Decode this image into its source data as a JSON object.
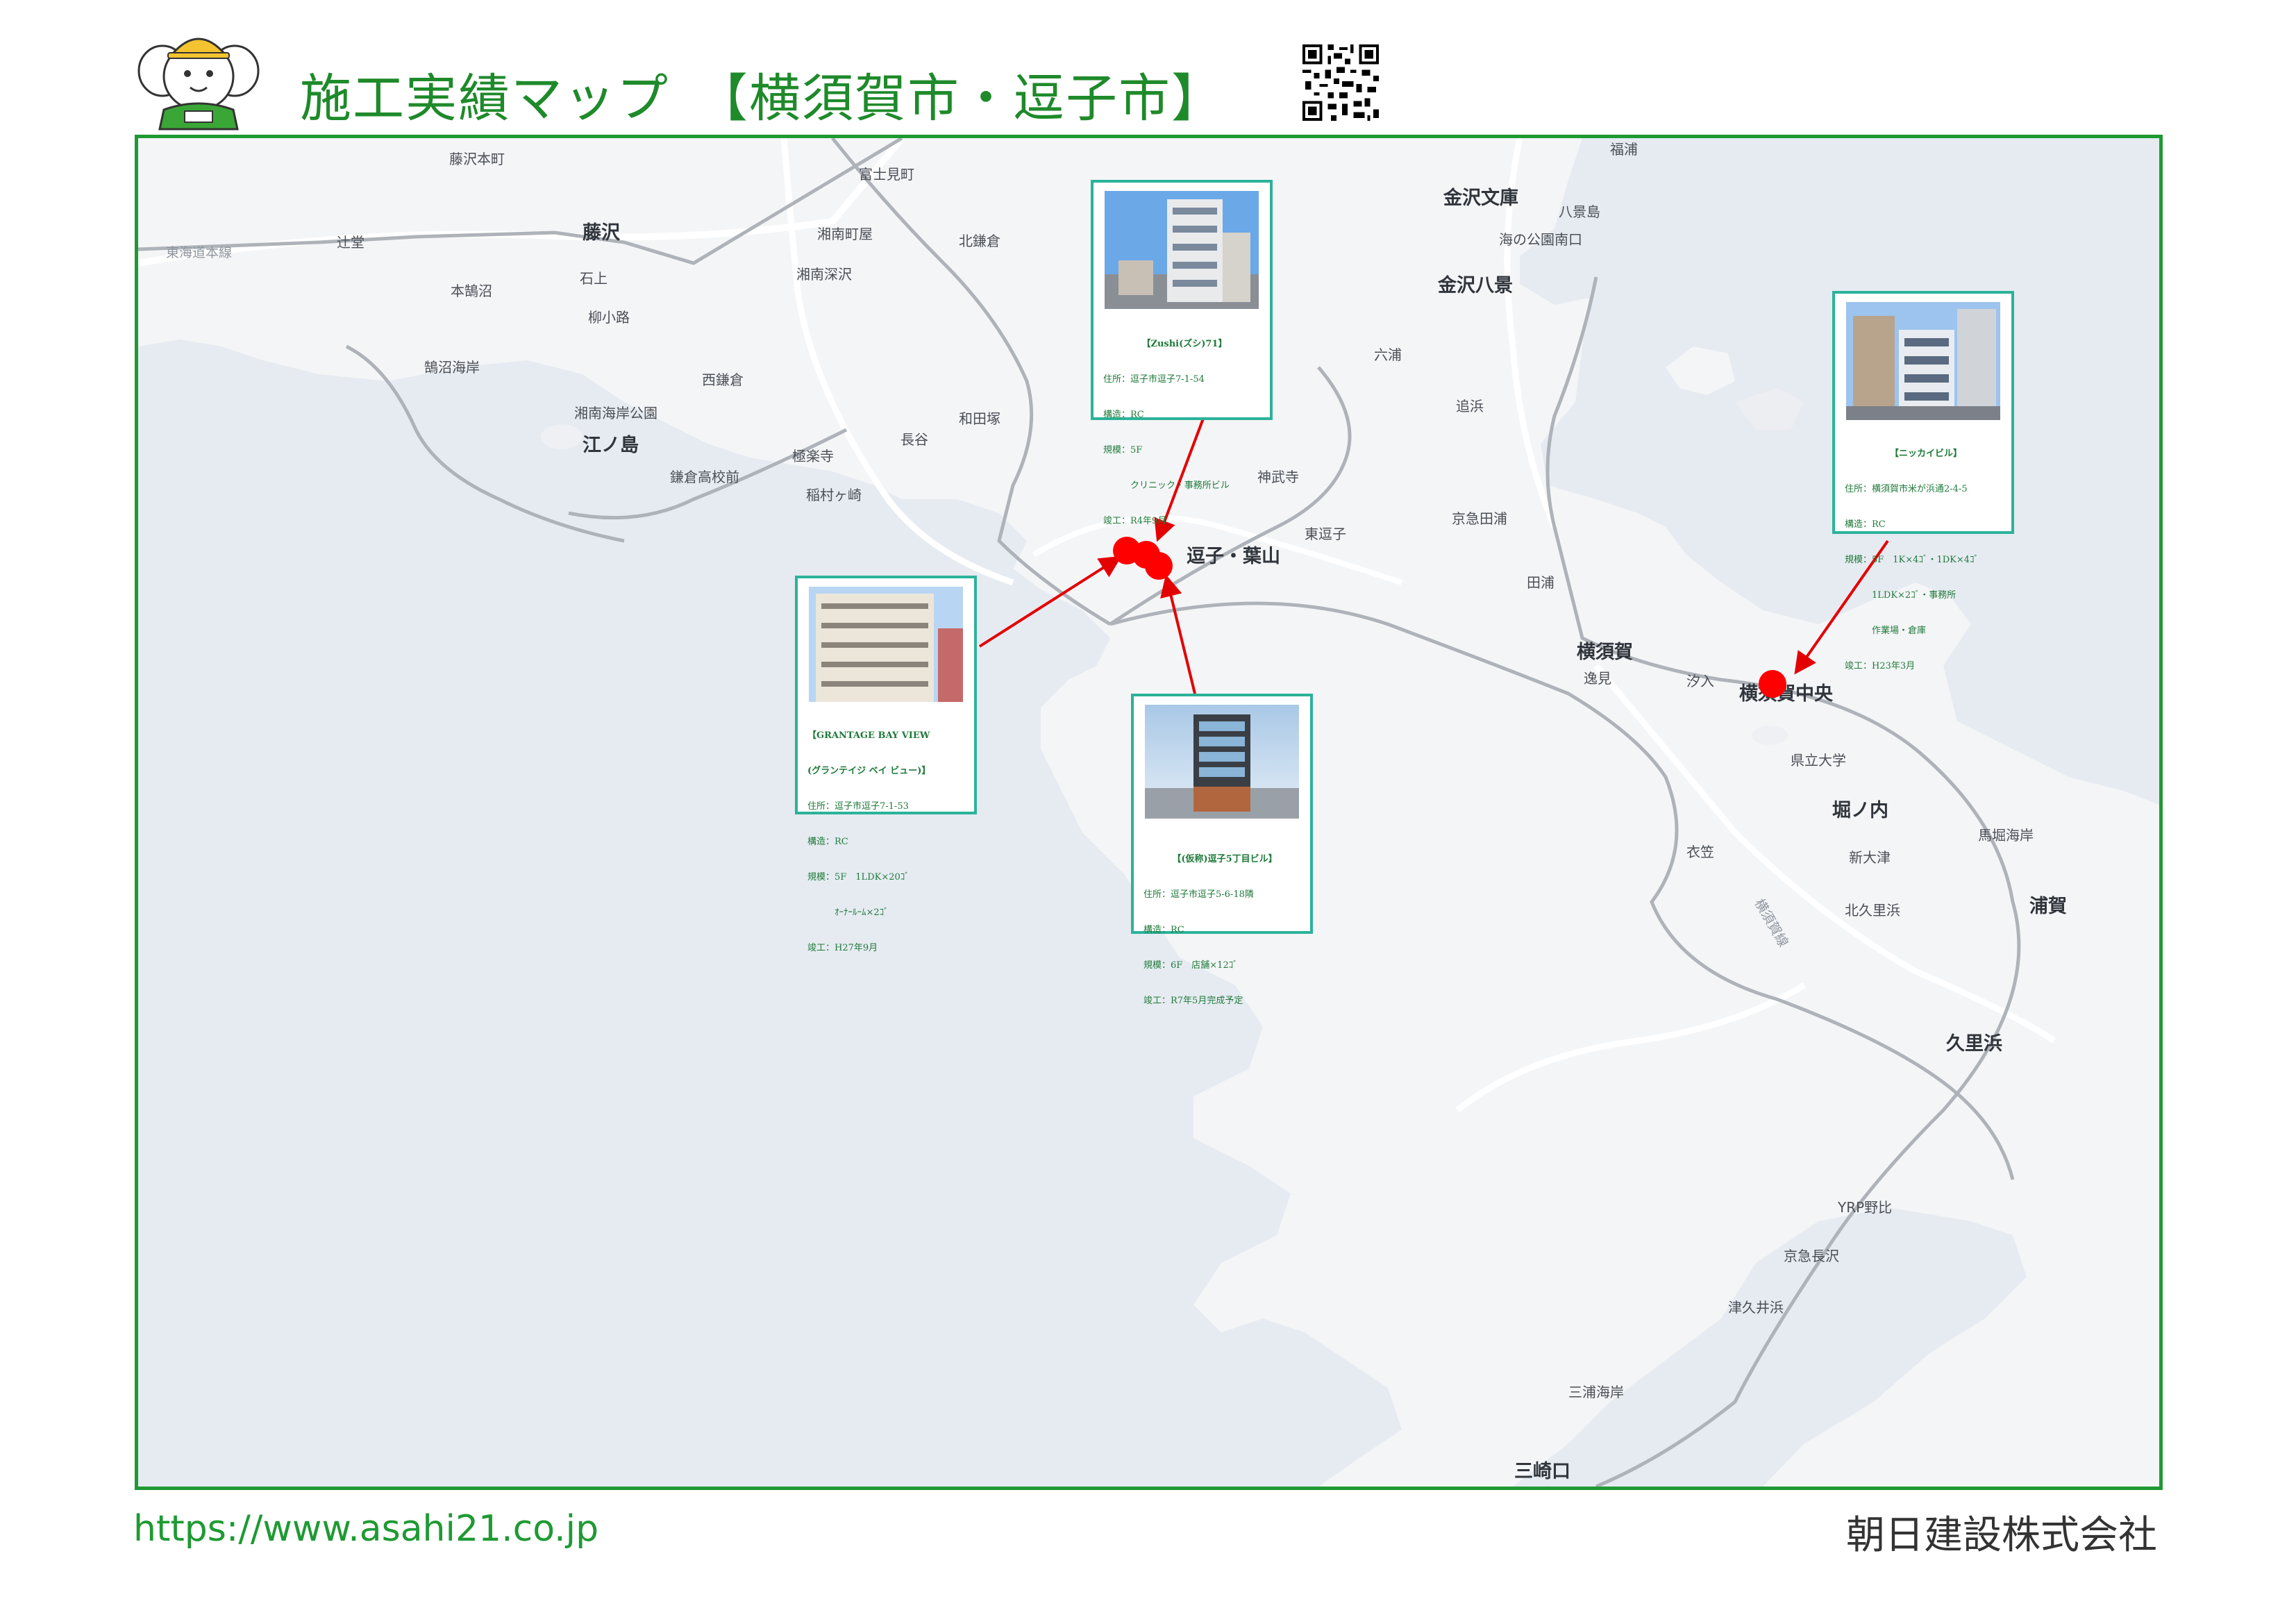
{
  "title": "施工実績マップ　【横須賀市・逗子市】",
  "footer": {
    "url": "https://www.asahi21.co.jp",
    "company": "朝日建設株式会社"
  },
  "colors": {
    "brand_green": "#1e9a33",
    "card_border": "#2bb39a",
    "pin": "#ff0000",
    "land": "#f3f4f6",
    "sea": "#e6ebf1"
  },
  "map_labels": {
    "fujisawa_honmachi": "藤沢本町",
    "fujimigaoka": "富士見町",
    "fujisawa": "藤沢",
    "tokaido": "東海道本線",
    "tsujido": "辻堂",
    "shonanmachiya": "湘南町屋",
    "kitakamakura": "北鎌倉",
    "ishigami": "石上",
    "honkugenuma": "本鵠沼",
    "shonanfukasawa": "湘南深沢",
    "yanagikoji": "柳小路",
    "nishikamakura": "西鎌倉",
    "kugenumakaigan": "鵠沼海岸",
    "shonankaigankoen": "湘南海岸公園",
    "enoshima": "江ノ島",
    "wadazuka": "和田塚",
    "gokurakuji": "極楽寺",
    "hase": "長谷",
    "kamakurakokomae": "鎌倉高校前",
    "inamuragasaki": "稲村ヶ崎",
    "jimmuji": "神武寺",
    "zushi_hayama": "逗子・葉山",
    "higashizushi": "東逗子",
    "kanazawabunko": "金沢文庫",
    "kanazawahakkei": "金沢八景",
    "uminokoen": "海の公園南口",
    "hakkeijima": "八景島",
    "fukura": "福浦",
    "mutsuura": "六浦",
    "oppama": "追浜",
    "keikyutaura": "京急田浦",
    "taura": "田浦",
    "yokosuka": "横須賀",
    "hemi": "逸見",
    "shioiri": "汐入",
    "yokosukachuo": "横須賀中央",
    "kenritsudaigaku": "県立大学",
    "horinouchi": "堀ノ内",
    "kinugasa": "衣笠",
    "shinotsu": "新大津",
    "maborikaigan": "馬堀海岸",
    "uraga": "浦賀",
    "kitakurihama": "北久里浜",
    "kurihama": "久里浜",
    "yrpnobi": "YRP野比",
    "keikyunagasawa": "京急長沢",
    "tsukuihama": "津久井浜",
    "miurakaigan": "三浦海岸",
    "misakiguchi": "三崎口",
    "yokosukaline": "横須賀線"
  },
  "projects": [
    {
      "name": "【Zushi(ズシ)71】",
      "address": "住所：逗子市逗子7-1-54",
      "structure": "構造：RC",
      "scale": "規模：5F",
      "scale2": "　　　クリニック・事務所ビル",
      "completion": "竣工：R4年9月"
    },
    {
      "name": "【ニッカイビル】",
      "address": "住所：横須賀市米が浜通2-4-5",
      "structure": "構造：RC",
      "scale": "規模：5F　1K×4ｺﾞ・1DK×4ｺﾞ",
      "scale2": "　　　1LDK×2ｺﾞ・事務所",
      "scale3": "　　　作業場・倉庫",
      "completion": "竣工：H23年3月"
    },
    {
      "name": "【GRANTAGE BAY VIEW",
      "name2": "(グランテイジ ベイ ビュー)】",
      "address": "住所：逗子市逗子7-1-53",
      "structure": "構造：RC",
      "scale": "規模：5F　1LDK×20ｺﾞ",
      "scale2": "　　　ｵｰﾅｰﾙｰﾑ×2ｺﾞ",
      "completion": "竣工：H27年9月"
    },
    {
      "name": "【(仮称)逗子5丁目ビル】",
      "address": "住所：逗子市逗子5-6-18隣",
      "structure": "構造：RC",
      "scale": "規模：6F　店舗×12ｺﾞ",
      "completion": "竣工：R7年5月完成予定"
    }
  ]
}
